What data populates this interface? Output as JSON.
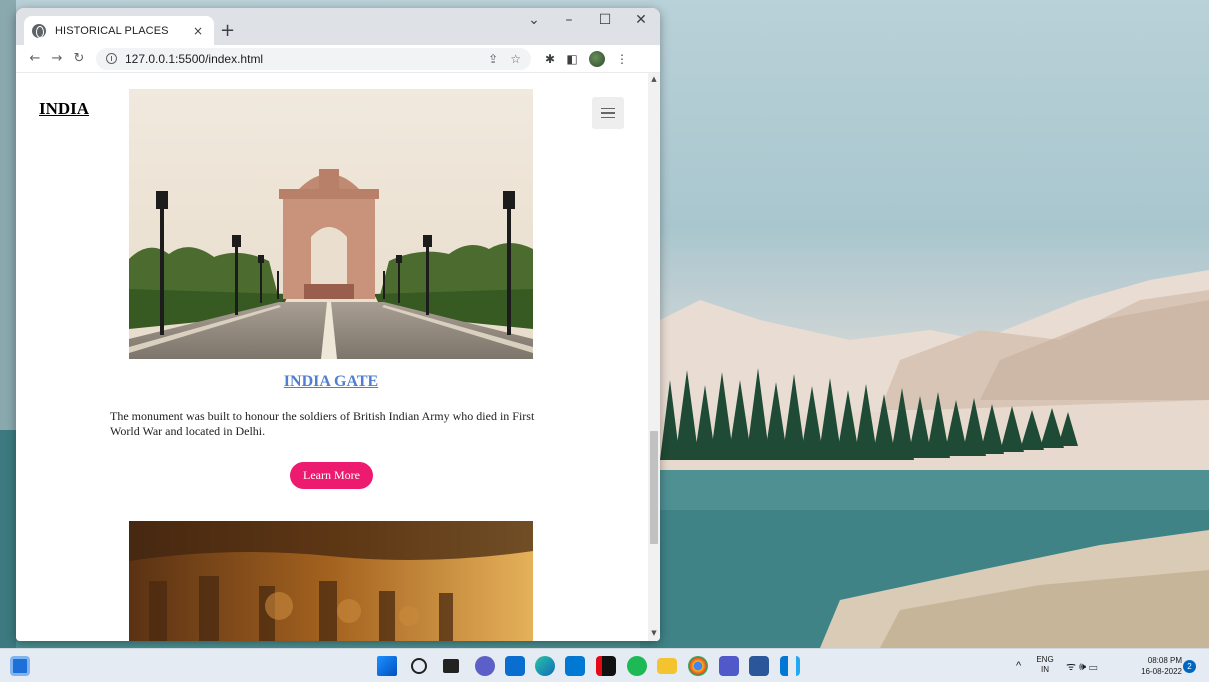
{
  "browser": {
    "tab_title": "HISTORICAL PLACES",
    "tab_close": "×",
    "new_tab": "+",
    "url": "127.0.0.1:5500/index.html",
    "controls": {
      "dropdown": "⌄",
      "minimize": "–",
      "maximize": "☐",
      "close": "✕"
    },
    "nav": {
      "back": "←",
      "forward": "→",
      "reload": "↻"
    },
    "omnibox_icons": {
      "share": "⇪",
      "bookmark": "☆"
    },
    "toolbar_icons": {
      "extensions": "✱",
      "sidepanel": "◧",
      "menu": "⋮"
    }
  },
  "page": {
    "brand": "INDIA",
    "card": {
      "title": "INDIA GATE",
      "description": "The monument was built to honour the soldiers of British Indian Army who died in First World War and located in Delhi.",
      "button_label": "Learn More"
    }
  },
  "taskbar": {
    "language": "ENG",
    "region": "IN",
    "time": "08:08 PM",
    "date": "16-08-2022",
    "notification_count": "2",
    "tray_chevron": "^",
    "tray_icons": "ᯤ 🕪 ▭"
  },
  "colors": {
    "accent_button": "#ec1b6f",
    "title_link": "#4f7fd0",
    "taskbar": "#e4ebf2"
  }
}
